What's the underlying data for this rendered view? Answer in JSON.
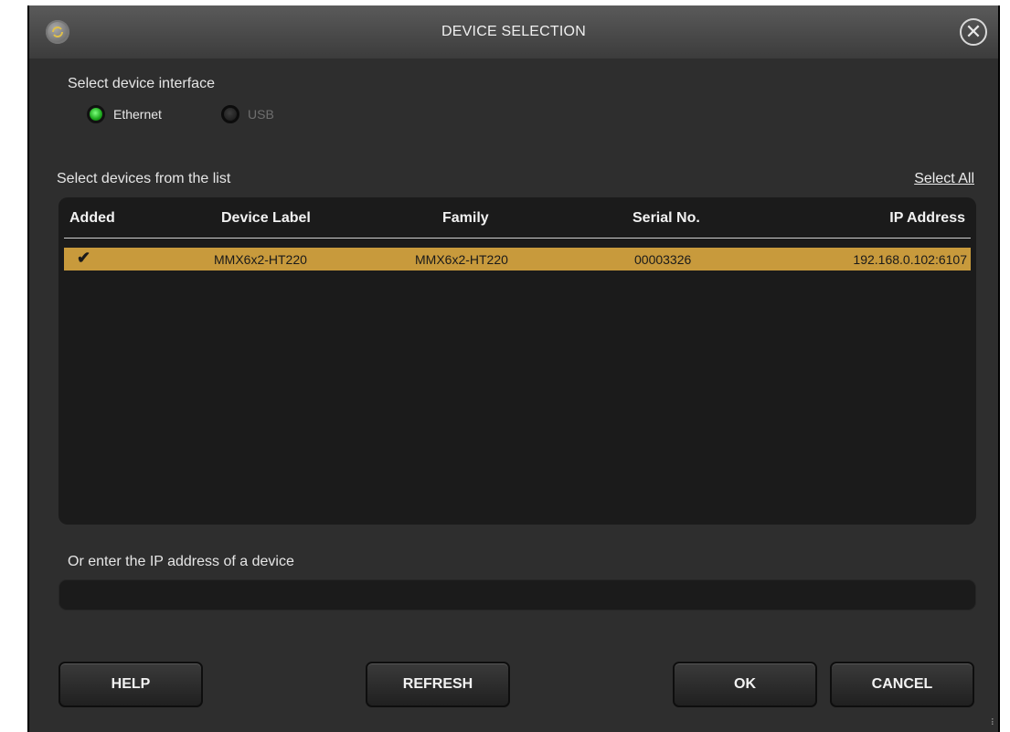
{
  "window": {
    "title": "DEVICE SELECTION"
  },
  "interface": {
    "label": "Select device interface",
    "options": [
      {
        "label": "Ethernet",
        "selected": true,
        "enabled": true
      },
      {
        "label": "USB",
        "selected": false,
        "enabled": false
      }
    ]
  },
  "list": {
    "label": "Select devices from the list",
    "select_all": "Select All",
    "columns": [
      "Added",
      "Device Label",
      "Family",
      "Serial No.",
      "IP Address"
    ],
    "rows": [
      {
        "added": "✔",
        "device_label": "MMX6x2-HT220",
        "family": "MMX6x2-HT220",
        "serial": "00003326",
        "ip": "192.168.0.102:6107",
        "selected": true
      }
    ],
    "selected_row_color": "#c89a3c"
  },
  "manual": {
    "label": "Or enter the IP address of a device",
    "value": ""
  },
  "buttons": {
    "help": "HELP",
    "refresh": "REFRESH",
    "ok": "OK",
    "cancel": "CANCEL"
  },
  "colors": {
    "window_bg": "#2e2e2e",
    "panel_bg": "#1b1b1b",
    "radio_on": "#1aa51a"
  }
}
